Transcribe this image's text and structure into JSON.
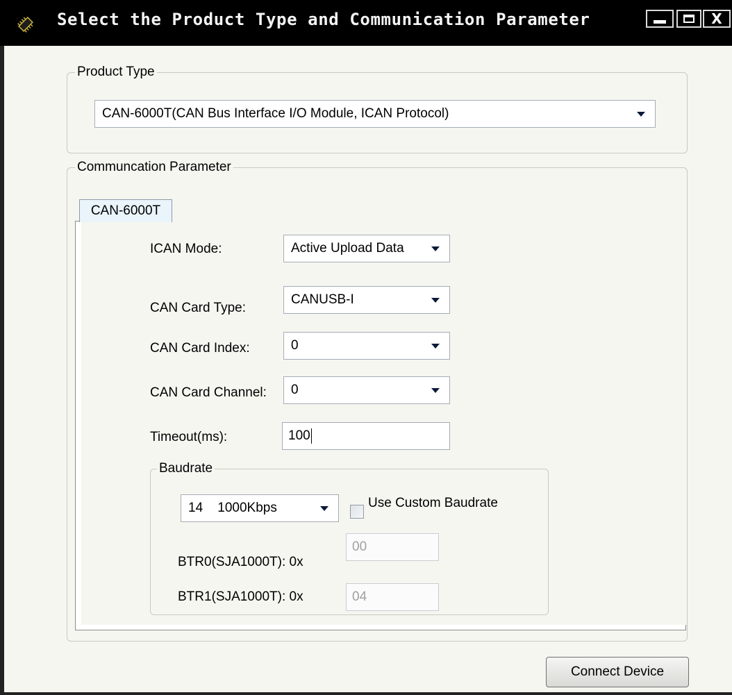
{
  "window": {
    "title": "Select the Product Type and Communication  Parameter",
    "minimize_icon": "minimize-icon",
    "maximize_icon": "maximize-icon",
    "close_label": "X"
  },
  "product_type": {
    "legend": "Product Type",
    "selected": "CAN-6000T(CAN Bus Interface I/O Module, ICAN Protocol)"
  },
  "comm": {
    "legend": "Communcation Parameter",
    "tab_label": "CAN-6000T",
    "ican_mode": {
      "label": "ICAN Mode:",
      "value": "Active Upload Data"
    },
    "card_type": {
      "label": "CAN Card Type:",
      "value": "CANUSB-I"
    },
    "card_index": {
      "label": "CAN Card Index:",
      "value": "0"
    },
    "card_channel": {
      "label": "CAN Card Channel:",
      "value": "0"
    },
    "timeout": {
      "label": "Timeout(ms):",
      "value": "100"
    },
    "baudrate": {
      "legend": "Baudrate",
      "selected": "14    1000Kbps",
      "custom_label": "Use Custom Baudrate",
      "custom_checked": false,
      "btr0": {
        "label": "BTR0(SJA1000T): 0x",
        "value": "00"
      },
      "btr1": {
        "label": "BTR1(SJA1000T): 0x",
        "value": "04"
      }
    }
  },
  "buttons": {
    "connect": "Connect Device"
  },
  "colors": {
    "titlebar": "#000000",
    "panel": "#f6f6f1",
    "tab": "#eaf4fb"
  }
}
